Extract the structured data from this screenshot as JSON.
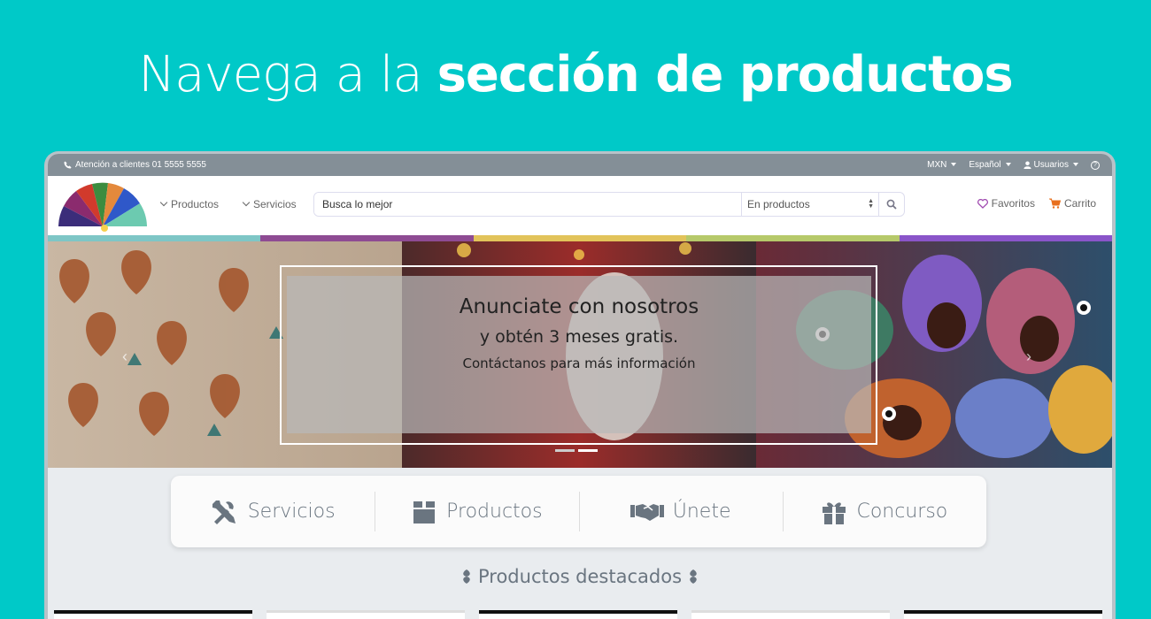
{
  "headline": {
    "prefix": "Navega a la ",
    "bold": "sección de productos"
  },
  "topbar": {
    "phone": "Atención a clientes 01 5555 5555",
    "currency": "MXN",
    "language": "Español",
    "users": "Usuarios"
  },
  "nav": {
    "products": "Productos",
    "services": "Servicios",
    "search_placeholder": "Busca lo mejor",
    "search_scope": "En productos",
    "favorites": "Favoritos",
    "cart": "Carrito"
  },
  "stripe_colors": [
    "#7ec6c6",
    "#8e4b93",
    "#e2c35a",
    "#b6c96a",
    "#8a55c9"
  ],
  "banner": {
    "line1": "Anunciate con nosotros",
    "line2": "y obtén 3 meses gratis.",
    "line3": "Contáctanos para más información",
    "active_slide": 2,
    "slides": 2
  },
  "categories": [
    {
      "label": "Servicios",
      "icon": "tools-icon"
    },
    {
      "label": "Productos",
      "icon": "box-icon"
    },
    {
      "label": "Únete",
      "icon": "handshake-icon"
    },
    {
      "label": "Concurso",
      "icon": "gift-icon"
    }
  ],
  "featured_title": "Productos destacados"
}
